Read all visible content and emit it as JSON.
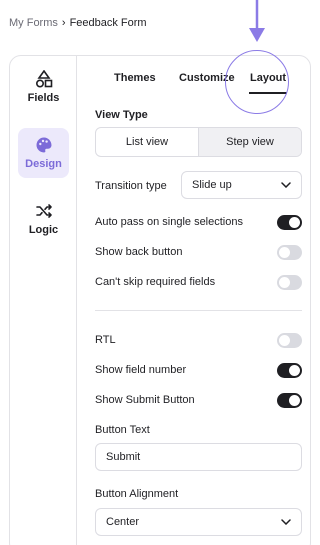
{
  "breadcrumb": {
    "parent": "My Forms",
    "separator": "›",
    "current": "Feedback Form"
  },
  "sidebar": {
    "items": [
      {
        "label": "Fields",
        "icon": "shapes-icon"
      },
      {
        "label": "Design",
        "icon": "palette-icon",
        "active": true
      },
      {
        "label": "Logic",
        "icon": "shuffle-icon"
      }
    ]
  },
  "tabs": [
    {
      "label": "Themes"
    },
    {
      "label": "Customize"
    },
    {
      "label": "Layout",
      "active": true
    }
  ],
  "view_type": {
    "title": "View Type",
    "options": [
      "List view",
      "Step view"
    ],
    "selected": "Step view"
  },
  "transition": {
    "label": "Transition type",
    "value": "Slide up"
  },
  "toggles": [
    {
      "label": "Auto pass on single selections",
      "on": true
    },
    {
      "label": "Show back button",
      "on": false
    },
    {
      "label": "Can't skip required fields",
      "on": false
    },
    {
      "label": "RTL",
      "on": false
    },
    {
      "label": "Show field number",
      "on": true
    },
    {
      "label": "Show Submit Button",
      "on": true
    }
  ],
  "button_text": {
    "label": "Button Text",
    "value": "Submit"
  },
  "button_alignment": {
    "label": "Button Alignment",
    "value": "Center"
  },
  "colors": {
    "accent": "#7c6bd8",
    "accent_bg": "#ece9fb",
    "toggle_on": "#1f1f23",
    "toggle_off": "#d9dae0"
  }
}
